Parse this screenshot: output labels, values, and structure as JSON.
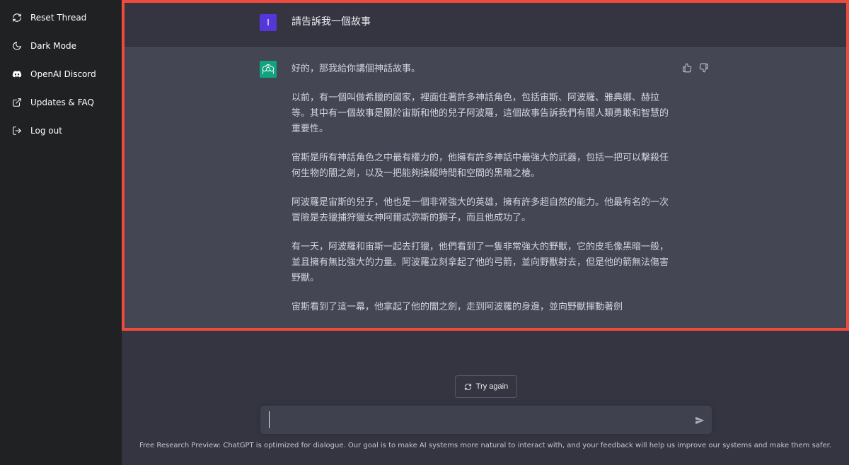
{
  "sidebar": {
    "items": [
      {
        "label": "Reset Thread",
        "icon": "refresh-icon"
      },
      {
        "label": "Dark Mode",
        "icon": "moon-icon"
      },
      {
        "label": "OpenAI Discord",
        "icon": "discord-icon"
      },
      {
        "label": "Updates & FAQ",
        "icon": "external-link-icon"
      },
      {
        "label": "Log out",
        "icon": "logout-icon"
      }
    ]
  },
  "thread": {
    "user": {
      "avatar_letter": "I",
      "message": "請告訴我一個故事"
    },
    "assistant": {
      "paragraphs": [
        "好的，那我給你講個神話故事。",
        "以前，有一個叫做希臘的國家，裡面住著許多神話角色，包括宙斯、阿波羅、雅典娜、赫拉等。其中有一個故事是關於宙斯和他的兒子阿波羅，這個故事告訴我們有關人類勇敢和智慧的重要性。",
        "宙斯是所有神話角色之中最有權力的，他擁有許多神話中最強大的武器，包括一把可以擊殺任何生物的闇之劍，以及一把能夠操縱時間和空間的黑暗之槍。",
        "阿波羅是宙斯的兒子，他也是一個非常強大的英雄，擁有許多超自然的能力。他最有名的一次冒險是去獵捕狩獵女神阿爾忒弥斯的獅子，而且他成功了。",
        "有一天，阿波羅和宙斯一起去打獵，他們看到了一隻非常強大的野獸，它的皮毛像黑暗一般，並且擁有無比強大的力量。阿波羅立刻拿起了他的弓箭，並向野獸射去，但是他的箭無法傷害野獸。",
        "宙斯看到了這一幕，他拿起了他的闇之劍，走到阿波羅的身邊，並向野獸揮動著劍"
      ]
    }
  },
  "actions": {
    "try_again_label": "Try again"
  },
  "composer": {
    "value": "",
    "placeholder": ""
  },
  "footer": {
    "note": "Free Research Preview: ChatGPT is optimized for dialogue. Our goal is to make AI systems more natural to interact with, and your feedback will help us improve our systems and make them safer."
  },
  "colors": {
    "sidebar_bg": "#202123",
    "main_bg": "#343541",
    "assistant_bg": "#444654",
    "user_avatar": "#5436da",
    "assistant_avatar": "#10a37f",
    "highlight_border": "#ee4b3e"
  }
}
